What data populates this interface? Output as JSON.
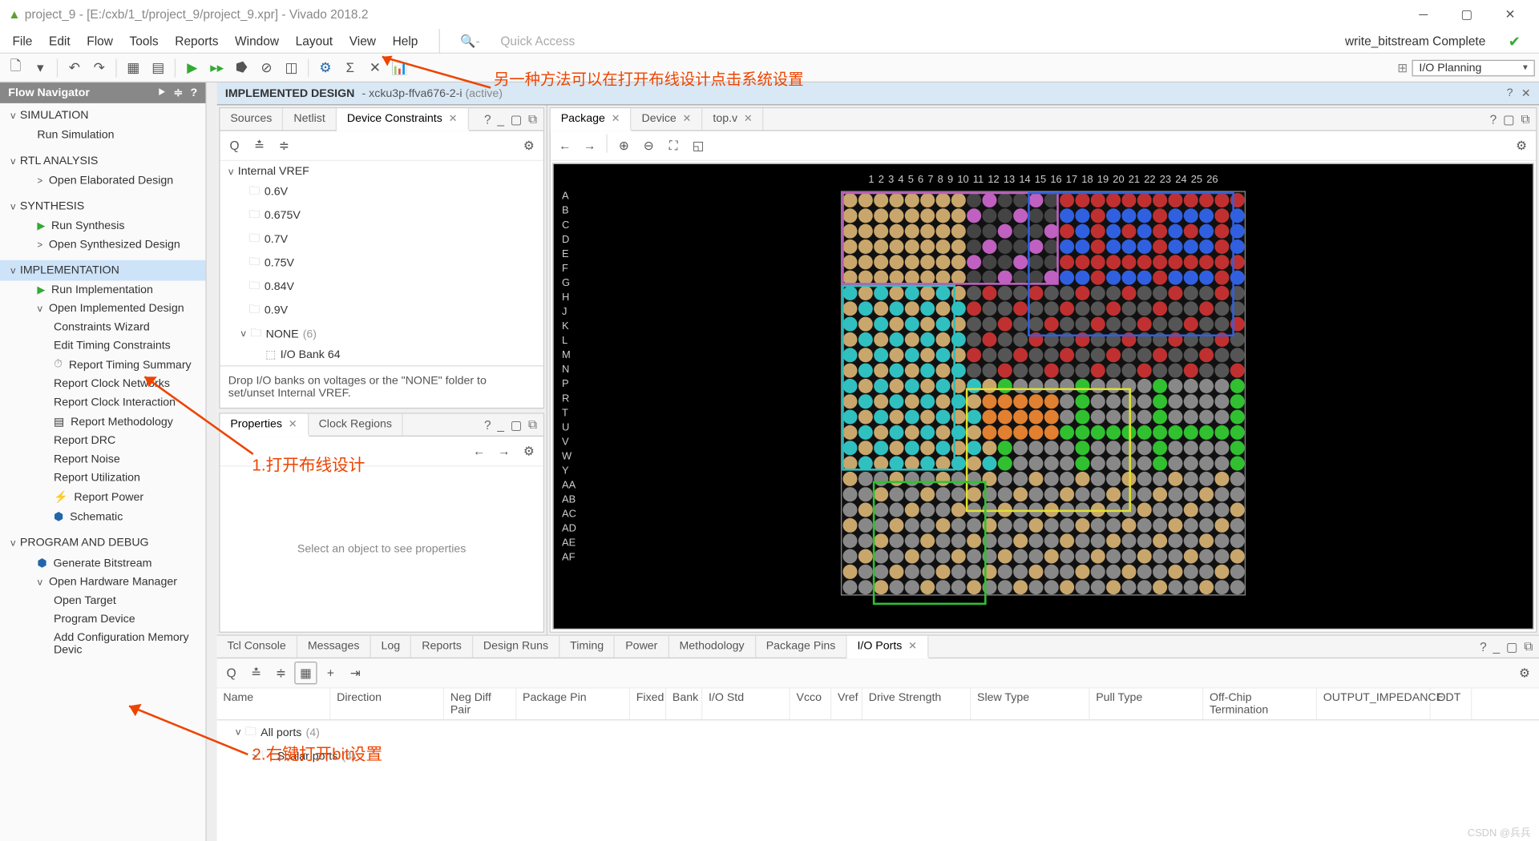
{
  "title": "project_9 - [E:/cxb/1_t/project_9/project_9.xpr] - Vivado 2018.2",
  "menu": [
    "File",
    "Edit",
    "Flow",
    "Tools",
    "Reports",
    "Window",
    "Layout",
    "View",
    "Help"
  ],
  "quick_access": "Quick Access",
  "status_right": "write_bitstream Complete",
  "layout_dd": "I/O Planning",
  "flow_nav": {
    "title": "Flow Navigator",
    "sections": [
      {
        "hdr": "SIMULATION",
        "items": [
          {
            "t": "Run Simulation",
            "ic": ""
          }
        ]
      },
      {
        "hdr": "RTL ANALYSIS",
        "items": [
          {
            "t": "Open Elaborated Design",
            "ic": ">",
            "exp": true
          }
        ]
      },
      {
        "hdr": "SYNTHESIS",
        "items": [
          {
            "t": "Run Synthesis",
            "ic": "play"
          },
          {
            "t": "Open Synthesized Design",
            "ic": ">",
            "exp": true
          }
        ]
      },
      {
        "hdr": "IMPLEMENTATION",
        "sel": true,
        "items": [
          {
            "t": "Run Implementation",
            "ic": "play"
          },
          {
            "t": "Open Implemented Design",
            "ic": "v",
            "exp": true,
            "mark": true,
            "sub": [
              {
                "t": "Constraints Wizard"
              },
              {
                "t": "Edit Timing Constraints"
              },
              {
                "t": "Report Timing Summary",
                "ic": "clock"
              },
              {
                "t": "Report Clock Networks"
              },
              {
                "t": "Report Clock Interaction"
              },
              {
                "t": "Report Methodology",
                "ic": "doc"
              },
              {
                "t": "Report DRC"
              },
              {
                "t": "Report Noise"
              },
              {
                "t": "Report Utilization"
              },
              {
                "t": "Report Power",
                "ic": "pwr"
              },
              {
                "t": "Schematic",
                "ic": "chip"
              }
            ]
          }
        ]
      },
      {
        "hdr": "PROGRAM AND DEBUG",
        "items": [
          {
            "t": "Generate Bitstream",
            "ic": "chip",
            "mark": true
          },
          {
            "t": "Open Hardware Manager",
            "ic": "v",
            "exp": true,
            "sub": [
              {
                "t": "Open Target"
              },
              {
                "t": "Program Device"
              },
              {
                "t": "Add Configuration Memory Devic"
              }
            ]
          }
        ]
      }
    ]
  },
  "impl_bar": {
    "title": "IMPLEMENTED DESIGN",
    "part": "xcku3p-ffva676-2-i",
    "state": "(active)"
  },
  "src_tabs": [
    "Sources",
    "Netlist",
    "Device Constraints"
  ],
  "src_tab_active": 2,
  "vref_tree": {
    "root": "Internal VREF",
    "items": [
      "0.6V",
      "0.675V",
      "0.7V",
      "0.75V",
      "0.84V",
      "0.9V"
    ],
    "none": "NONE",
    "none_count": "(6)",
    "bank": "I/O Bank 64"
  },
  "vref_hint": "Drop I/O banks on voltages or the \"NONE\" folder to set/unset Internal VREF.",
  "props_tabs": [
    "Properties",
    "Clock Regions"
  ],
  "props_empty": "Select an object to see properties",
  "pkg_tabs": [
    "Package",
    "Device",
    "top.v"
  ],
  "pkg_cols": [
    "1",
    "2",
    "3",
    "4",
    "5",
    "6",
    "7",
    "8",
    "9",
    "10",
    "11",
    "12",
    "13",
    "14",
    "15",
    "16",
    "17",
    "18",
    "19",
    "20",
    "21",
    "22",
    "23",
    "24",
    "25",
    "26"
  ],
  "pkg_rows": [
    "A",
    "B",
    "C",
    "D",
    "E",
    "F",
    "G",
    "H",
    "J",
    "K",
    "L",
    "M",
    "N",
    "P",
    "R",
    "T",
    "U",
    "V",
    "W",
    "Y",
    "AA",
    "AB",
    "AC",
    "AD",
    "AE",
    "AF"
  ],
  "bottom_tabs": [
    "Tcl Console",
    "Messages",
    "Log",
    "Reports",
    "Design Runs",
    "Timing",
    "Power",
    "Methodology",
    "Package Pins",
    "I/O Ports"
  ],
  "bottom_active": 9,
  "io_cols": [
    "Name",
    "Direction",
    "Neg Diff Pair",
    "Package Pin",
    "Fixed",
    "Bank",
    "I/O Std",
    "Vcco",
    "Vref",
    "Drive Strength",
    "Slew Type",
    "Pull Type",
    "Off-Chip Termination",
    "OUTPUT_IMPEDANCE",
    "ODT"
  ],
  "io_rows": [
    {
      "t": "All ports",
      "c": "(4)",
      "lvl": 0
    },
    {
      "t": "Scalar ports",
      "c": "(4)",
      "lvl": 1
    }
  ],
  "annotations": {
    "top": "另一种方法可以在打开布线设计点击系统设置",
    "step1": "1.打开布线设计",
    "step2": "2.右键打开bit设置"
  },
  "watermark": "CSDN @兵兵"
}
